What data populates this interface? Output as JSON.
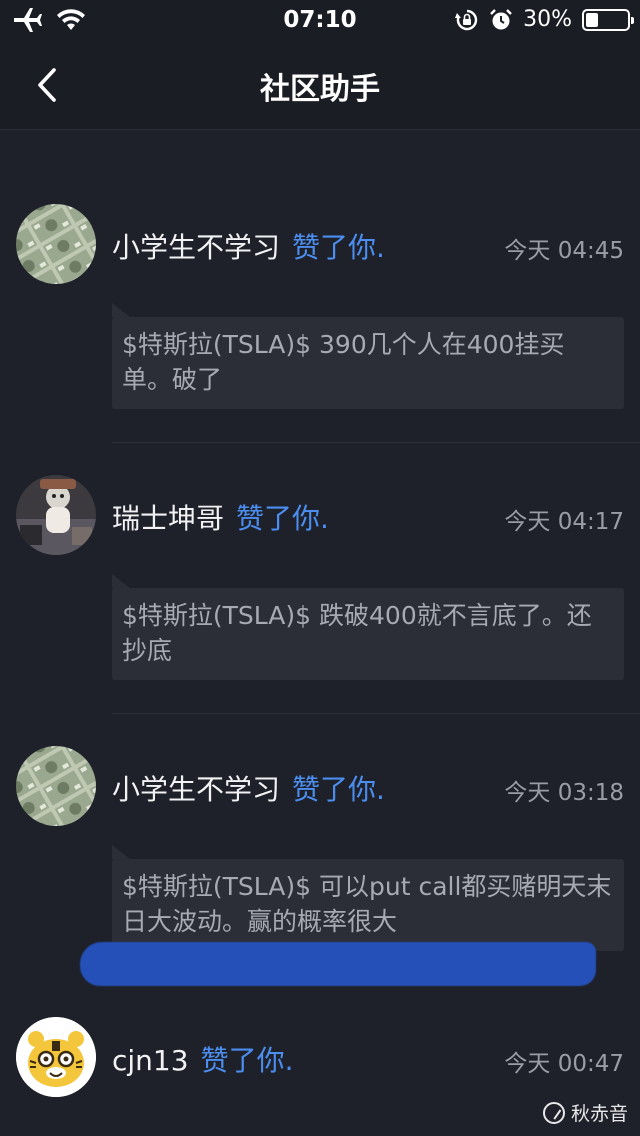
{
  "status_bar": {
    "time": "07:10",
    "battery_text": "30%",
    "battery_level": 0.3,
    "icons": [
      "airplane-icon",
      "wifi-icon",
      "rotation-lock-icon",
      "alarm-icon",
      "battery-icon"
    ]
  },
  "nav": {
    "title": "社区助手",
    "back_icon": "chevron-left-icon"
  },
  "notifications": [
    {
      "user": "小学生不学习",
      "action": "赞了你.",
      "time": "今天 04:45",
      "quote": "$特斯拉(TSLA)$ 390几个人在400挂买单。破了",
      "avatar": "money-avatar"
    },
    {
      "user": "瑞士坤哥",
      "action": "赞了你.",
      "time": "今天 04:17",
      "quote": "$特斯拉(TSLA)$ 跌破400就不言底了。还抄底",
      "avatar": "photo-avatar"
    },
    {
      "user": "小学生不学习",
      "action": "赞了你.",
      "time": "今天 03:18",
      "quote": "$特斯拉(TSLA)$ 可以put call都买赌明天末日大波动。赢的概率很大",
      "avatar": "money-avatar"
    },
    {
      "user": "cjn13",
      "action": "赞了你.",
      "time": "今天 00:47",
      "quote": "",
      "avatar": "tiger-avatar"
    }
  ],
  "colors": {
    "background": "#1e2129",
    "accent": "#4b8ef0",
    "quote_bg": "#2b2e36"
  },
  "watermark": "秋赤音"
}
